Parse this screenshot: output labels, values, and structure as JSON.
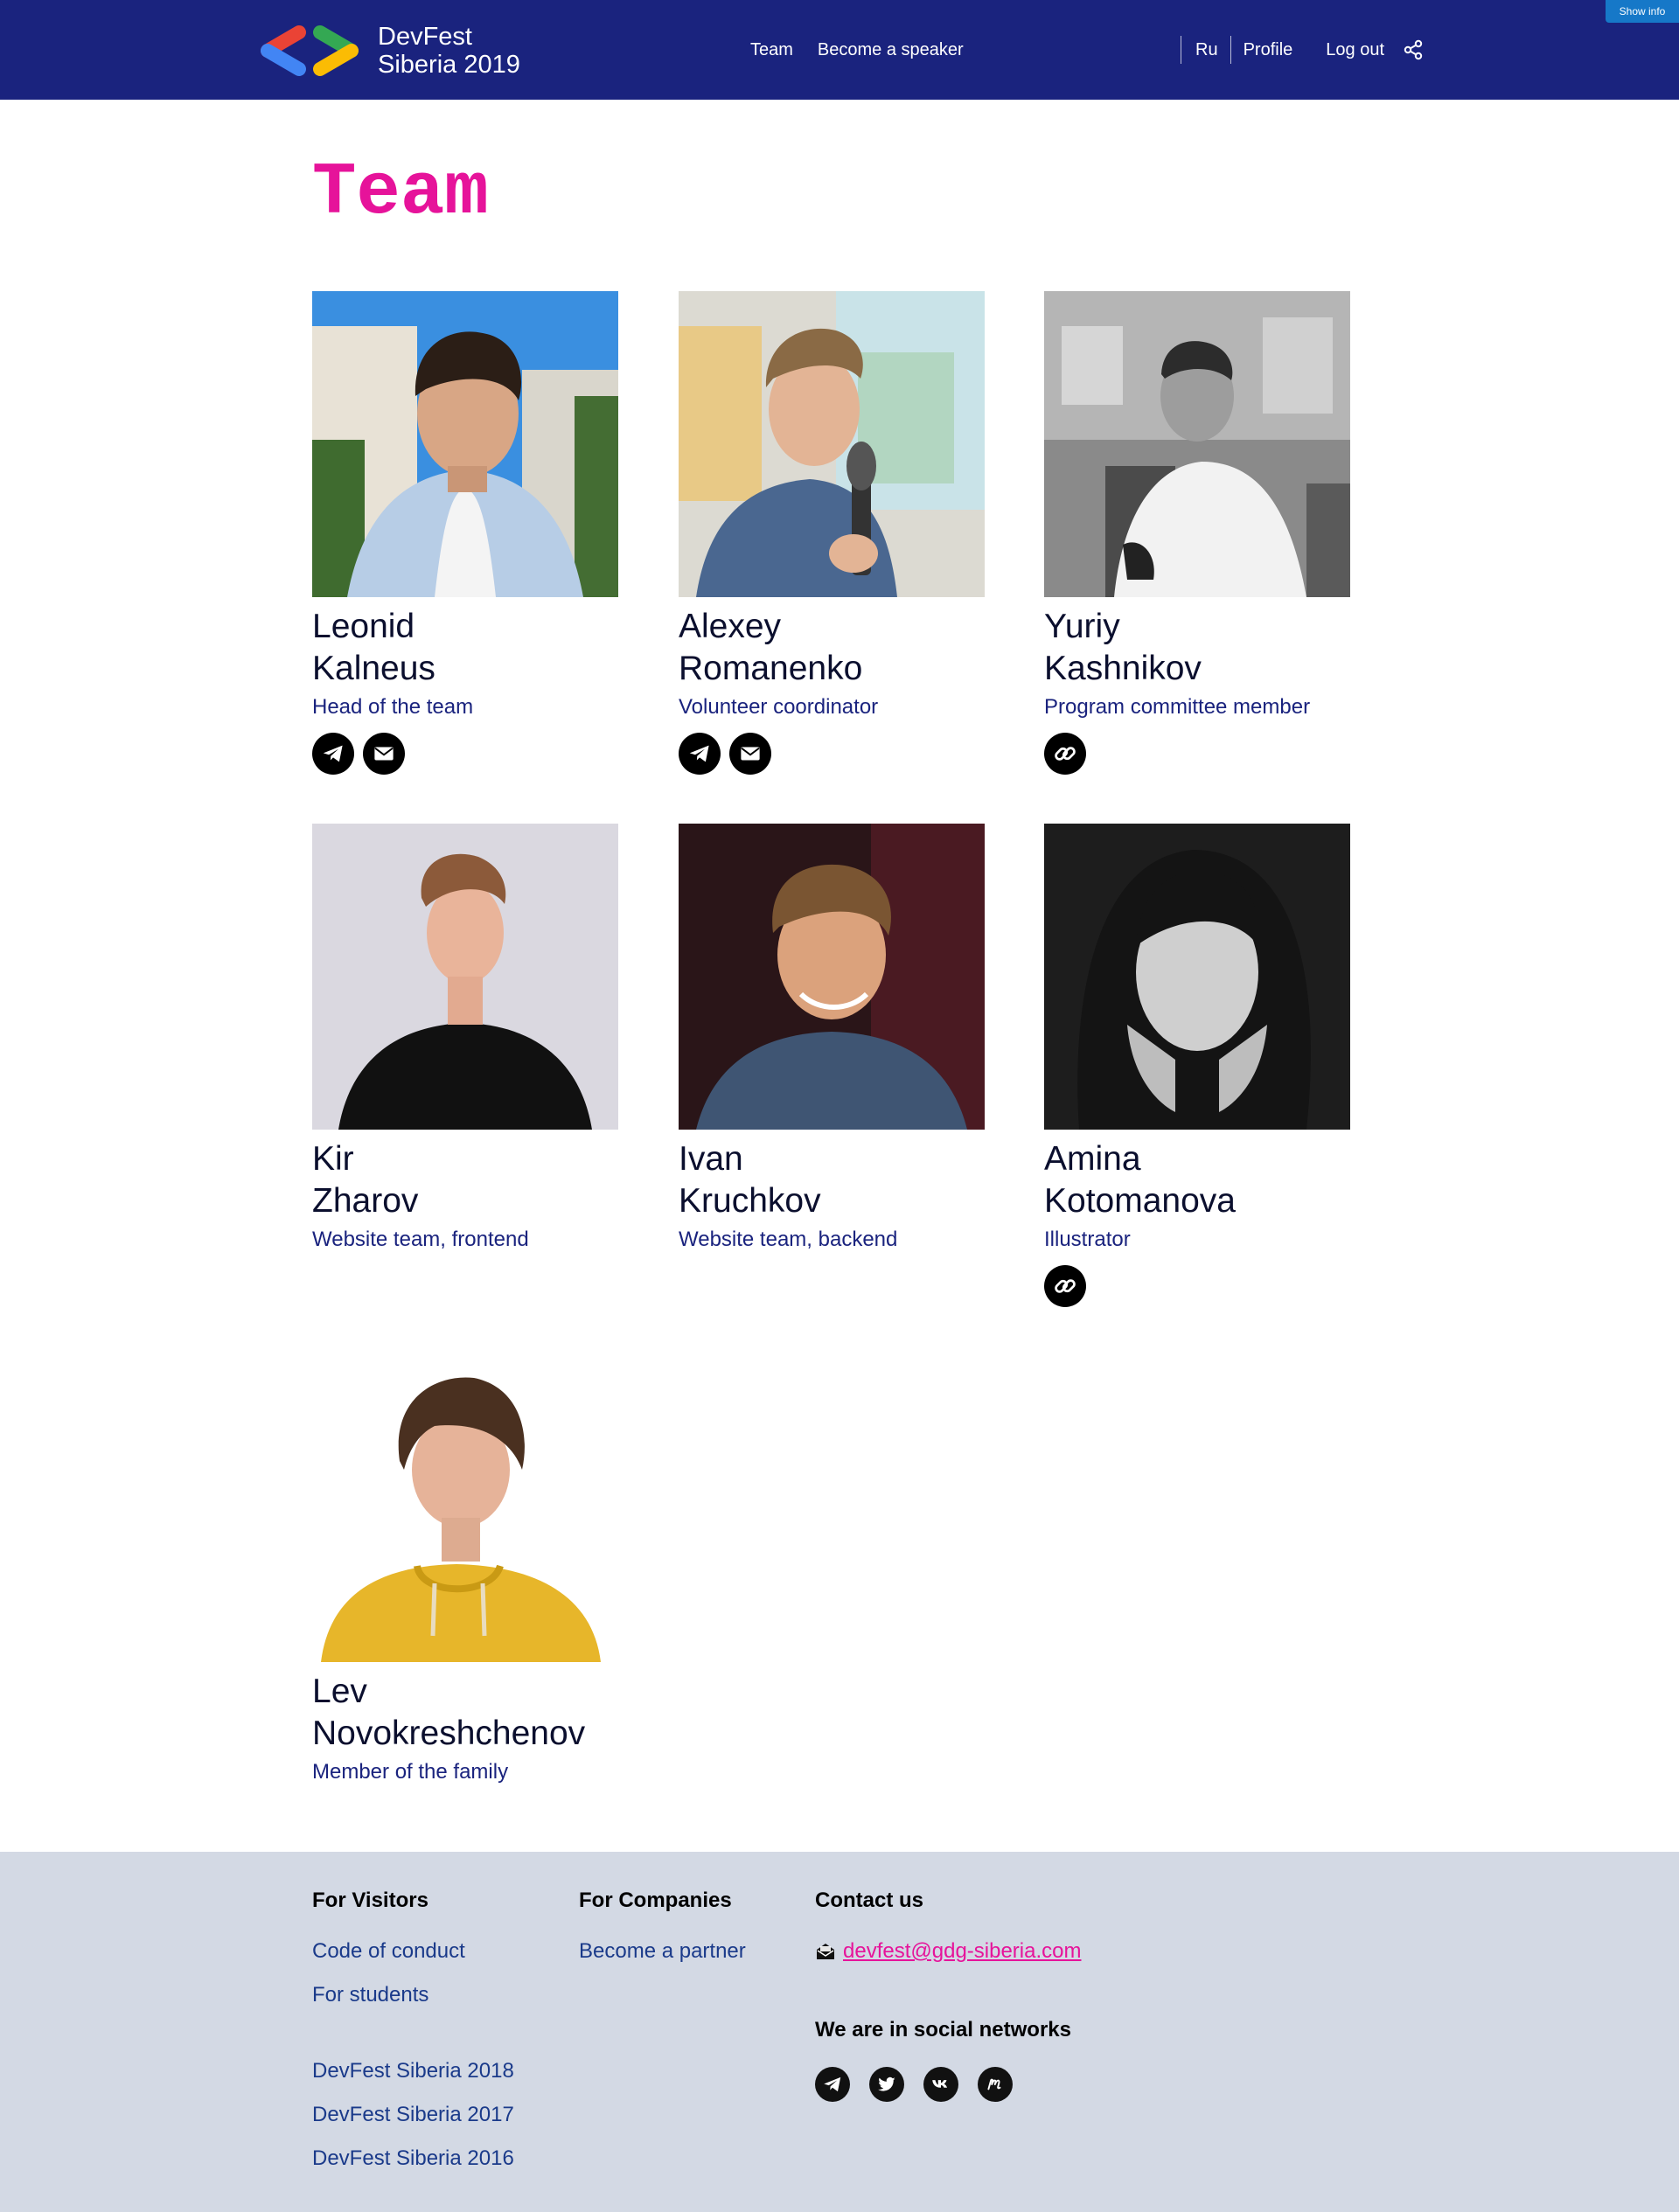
{
  "header": {
    "show_info": "Show info",
    "logo_line1": "DevFest",
    "logo_line2": "Siberia 2019",
    "nav": {
      "team": "Team",
      "speaker": "Become a speaker"
    },
    "lang": "Ru",
    "profile": "Profile",
    "logout": "Log out"
  },
  "page": {
    "title": "Team"
  },
  "team": [
    {
      "first": "Leonid",
      "last": "Kalneus",
      "role": "Head of the team",
      "socials": [
        "telegram-icon",
        "mail-icon"
      ]
    },
    {
      "first": "Alexey",
      "last": "Romanenko",
      "role": "Volunteer coordinator",
      "socials": [
        "telegram-icon",
        "mail-icon"
      ]
    },
    {
      "first": "Yuriy",
      "last": "Kashnikov",
      "role": "Program committee member",
      "socials": [
        "link-icon"
      ]
    },
    {
      "first": "Kir",
      "last": "Zharov",
      "role": "Website team, frontend",
      "socials": []
    },
    {
      "first": "Ivan",
      "last": "Kruchkov",
      "role": "Website team, backend",
      "socials": []
    },
    {
      "first": "Amina",
      "last": "Kotomanova",
      "role": "Illustrator",
      "socials": [
        "link-icon"
      ]
    },
    {
      "first": "Lev",
      "last": "Novokreshchenov",
      "role": "Member of the family",
      "socials": []
    }
  ],
  "footer": {
    "visitors": {
      "heading": "For Visitors",
      "links": [
        "Code of conduct",
        "For students",
        "DevFest Siberia 2018",
        "DevFest Siberia 2017",
        "DevFest Siberia 2016"
      ]
    },
    "companies": {
      "heading": "For Companies",
      "links": [
        "Become a partner"
      ]
    },
    "contact": {
      "heading": "Contact us",
      "email": "devfest@gdg-siberia.com",
      "social_heading": "We are in social networks",
      "socials": [
        "telegram-icon",
        "twitter-icon",
        "vk-icon",
        "meetup-icon"
      ]
    }
  },
  "colors": {
    "header_bg": "#1a237e",
    "accent_pink": "#e6139a",
    "role_text": "#1a237e",
    "footer_bg": "#d3d9e4",
    "show_info_bg": "#1678c8"
  }
}
